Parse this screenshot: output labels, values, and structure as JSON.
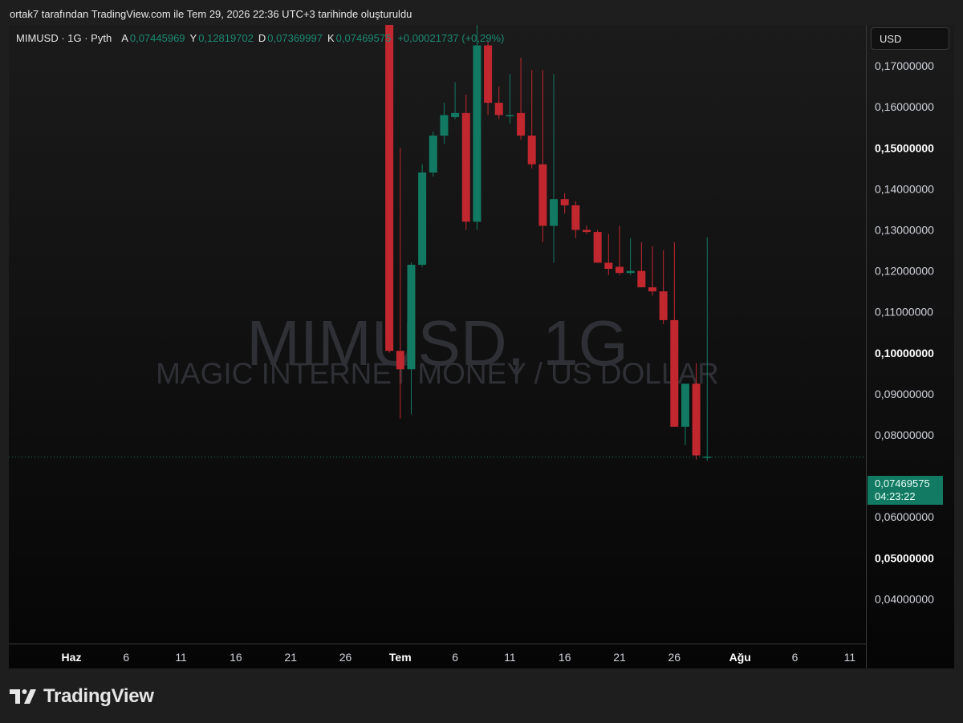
{
  "caption": "ortak7 tarafından TradingView.com ile Tem 29, 2026 22:36 UTC+3 tarihinde oluşturuldu",
  "legend": {
    "symbol": "MIMUSD · 1G · Pyth",
    "open_label": "A",
    "open": "0,07445969",
    "high_label": "Y",
    "high": "0,12819702",
    "low_label": "D",
    "low": "0,07369997",
    "close_label": "K",
    "close": "0,07469575",
    "change": "+0,00021737 (+0,29%)"
  },
  "watermark": {
    "symbol": "MIMUSD, 1G",
    "description": "MAGIC INTERNET MONEY / US DOLLAR"
  },
  "currency": "USD",
  "last_price": {
    "price": "0,07469575",
    "countdown": "04:23:22"
  },
  "branding": {
    "logo_text": "TradingView"
  },
  "colors": {
    "up": "#127a62",
    "down": "#c1272f",
    "background": "#1e1e1e",
    "text": "#d1d4dc"
  },
  "chart_data": {
    "type": "candlestick",
    "ylim": [
      0.0375,
      0.18
    ],
    "last_value": 0.07469575,
    "y_ticks": [
      {
        "value": 0.04,
        "label": "0,04000000",
        "bold": false
      },
      {
        "value": 0.05,
        "label": "0,05000000",
        "bold": true
      },
      {
        "value": 0.06,
        "label": "0,06000000",
        "bold": false
      },
      {
        "value": 0.08,
        "label": "0,08000000",
        "bold": false
      },
      {
        "value": 0.09,
        "label": "0,09000000",
        "bold": false
      },
      {
        "value": 0.1,
        "label": "0,10000000",
        "bold": true
      },
      {
        "value": 0.11,
        "label": "0,11000000",
        "bold": false
      },
      {
        "value": 0.12,
        "label": "0,12000000",
        "bold": false
      },
      {
        "value": 0.13,
        "label": "0,13000000",
        "bold": false
      },
      {
        "value": 0.14,
        "label": "0,14000000",
        "bold": false
      },
      {
        "value": 0.15,
        "label": "0,15000000",
        "bold": true
      },
      {
        "value": 0.16,
        "label": "0,16000000",
        "bold": false
      },
      {
        "value": 0.17,
        "label": "0,17000000",
        "bold": false
      }
    ],
    "x_ticks": [
      {
        "day": -9,
        "label": "26",
        "bold": false
      },
      {
        "day": 0,
        "label": "Haz",
        "bold": true
      },
      {
        "day": 5,
        "label": "6",
        "bold": false
      },
      {
        "day": 10,
        "label": "11",
        "bold": false
      },
      {
        "day": 15,
        "label": "16",
        "bold": false
      },
      {
        "day": 20,
        "label": "21",
        "bold": false
      },
      {
        "day": 25,
        "label": "26",
        "bold": false
      },
      {
        "day": 30,
        "label": "Tem",
        "bold": true
      },
      {
        "day": 35,
        "label": "6",
        "bold": false
      },
      {
        "day": 40,
        "label": "11",
        "bold": false
      },
      {
        "day": 45,
        "label": "16",
        "bold": false
      },
      {
        "day": 50,
        "label": "21",
        "bold": false
      },
      {
        "day": 55,
        "label": "26",
        "bold": false
      },
      {
        "day": 61,
        "label": "Ağu",
        "bold": true
      },
      {
        "day": 66,
        "label": "6",
        "bold": false
      },
      {
        "day": 71,
        "label": "11",
        "bold": false
      }
    ],
    "candles": [
      {
        "day": 29,
        "o": 0.185,
        "h": 0.185,
        "l": 0.1,
        "c": 0.1005
      },
      {
        "day": 30,
        "o": 0.1005,
        "h": 0.15,
        "l": 0.084,
        "c": 0.096
      },
      {
        "day": 31,
        "o": 0.096,
        "h": 0.122,
        "l": 0.085,
        "c": 0.1215
      },
      {
        "day": 32,
        "o": 0.1215,
        "h": 0.146,
        "l": 0.121,
        "c": 0.144
      },
      {
        "day": 33,
        "o": 0.144,
        "h": 0.154,
        "l": 0.143,
        "c": 0.153
      },
      {
        "day": 34,
        "o": 0.153,
        "h": 0.161,
        "l": 0.151,
        "c": 0.158
      },
      {
        "day": 35,
        "o": 0.1575,
        "h": 0.166,
        "l": 0.157,
        "c": 0.1585
      },
      {
        "day": 36,
        "o": 0.1585,
        "h": 0.163,
        "l": 0.13,
        "c": 0.132
      },
      {
        "day": 37,
        "o": 0.132,
        "h": 0.182,
        "l": 0.13,
        "c": 0.175
      },
      {
        "day": 38,
        "o": 0.175,
        "h": 0.176,
        "l": 0.158,
        "c": 0.161
      },
      {
        "day": 39,
        "o": 0.161,
        "h": 0.165,
        "l": 0.157,
        "c": 0.158
      },
      {
        "day": 40,
        "o": 0.158,
        "h": 0.168,
        "l": 0.156,
        "c": 0.158
      },
      {
        "day": 41,
        "o": 0.1585,
        "h": 0.172,
        "l": 0.152,
        "c": 0.153
      },
      {
        "day": 42,
        "o": 0.153,
        "h": 0.169,
        "l": 0.145,
        "c": 0.146
      },
      {
        "day": 43,
        "o": 0.146,
        "h": 0.169,
        "l": 0.127,
        "c": 0.131
      },
      {
        "day": 44,
        "o": 0.131,
        "h": 0.168,
        "l": 0.122,
        "c": 0.1375
      },
      {
        "day": 45,
        "o": 0.1375,
        "h": 0.139,
        "l": 0.134,
        "c": 0.136
      },
      {
        "day": 46,
        "o": 0.136,
        "h": 0.137,
        "l": 0.128,
        "c": 0.13
      },
      {
        "day": 47,
        "o": 0.13,
        "h": 0.131,
        "l": 0.129,
        "c": 0.1295
      },
      {
        "day": 48,
        "o": 0.1295,
        "h": 0.13,
        "l": 0.122,
        "c": 0.122
      },
      {
        "day": 49,
        "o": 0.122,
        "h": 0.129,
        "l": 0.119,
        "c": 0.1205
      },
      {
        "day": 50,
        "o": 0.121,
        "h": 0.131,
        "l": 0.119,
        "c": 0.1195
      },
      {
        "day": 51,
        "o": 0.1195,
        "h": 0.128,
        "l": 0.119,
        "c": 0.12
      },
      {
        "day": 52,
        "o": 0.12,
        "h": 0.127,
        "l": 0.116,
        "c": 0.116
      },
      {
        "day": 53,
        "o": 0.116,
        "h": 0.126,
        "l": 0.114,
        "c": 0.115
      },
      {
        "day": 54,
        "o": 0.115,
        "h": 0.125,
        "l": 0.107,
        "c": 0.108
      },
      {
        "day": 55,
        "o": 0.108,
        "h": 0.127,
        "l": 0.082,
        "c": 0.082
      },
      {
        "day": 56,
        "o": 0.082,
        "h": 0.0925,
        "l": 0.0775,
        "c": 0.0925
      },
      {
        "day": 57,
        "o": 0.0925,
        "h": 0.0975,
        "l": 0.074,
        "c": 0.075
      },
      {
        "day": 58,
        "o": 0.07445969,
        "h": 0.12819702,
        "l": 0.07369997,
        "c": 0.07469575
      }
    ]
  }
}
